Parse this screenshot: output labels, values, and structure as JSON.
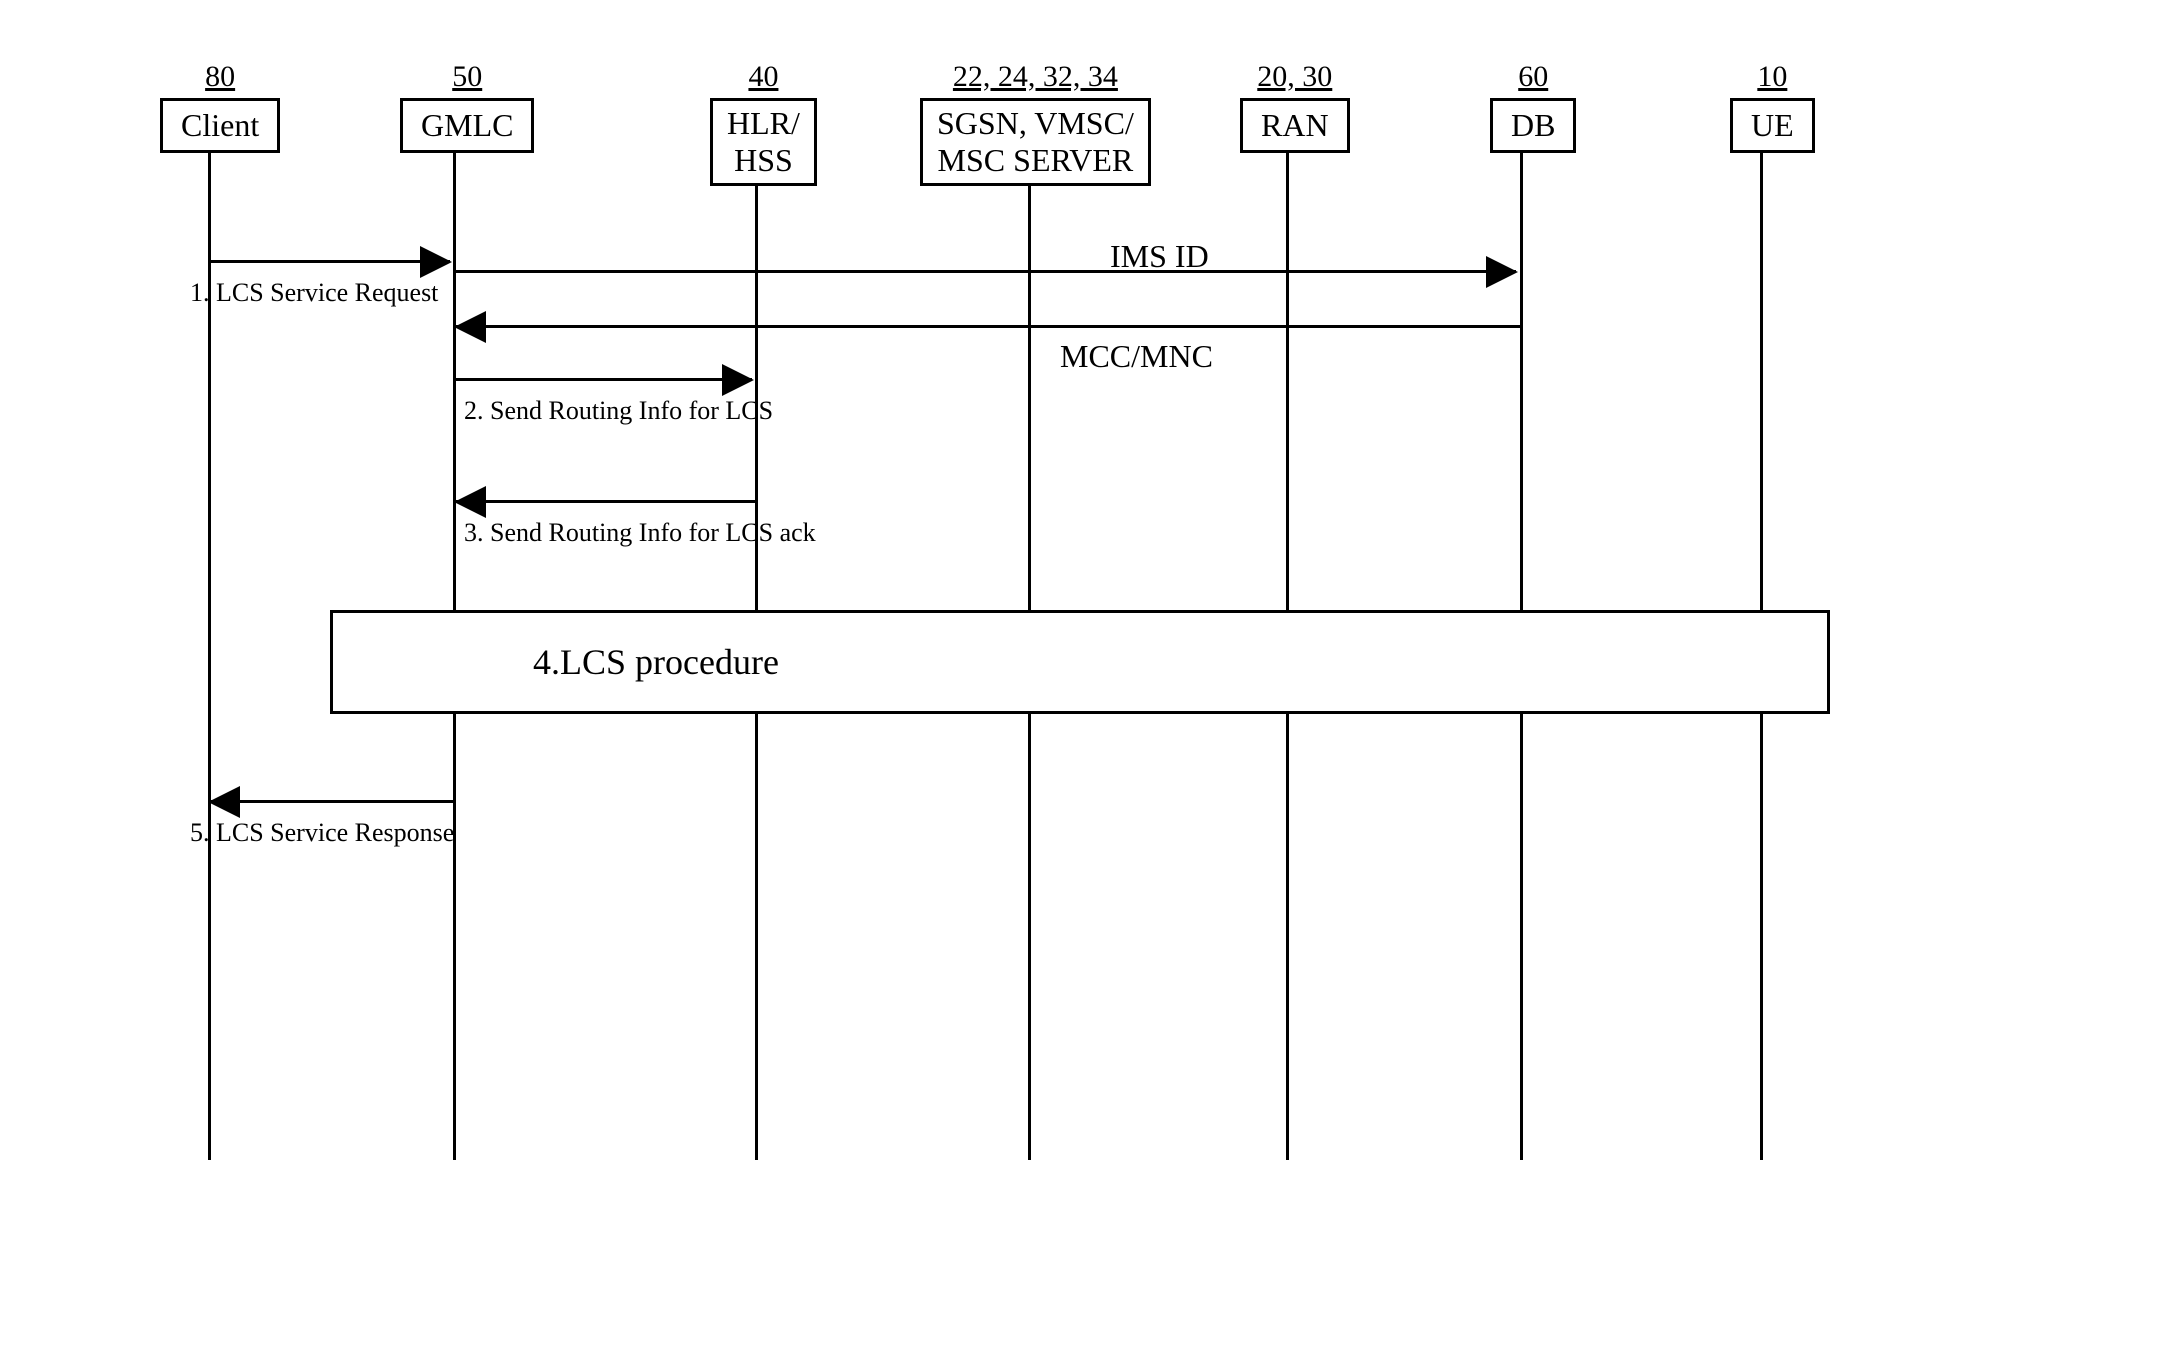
{
  "participants": {
    "client": {
      "number": "80",
      "label": "Client"
    },
    "gmlc": {
      "number": "50",
      "label": "GMLC"
    },
    "hlr": {
      "number": "40",
      "label1": "HLR/",
      "label2": "HSS"
    },
    "sgsn": {
      "number": "22, 24, 32, 34",
      "label1": "SGSN, VMSC/",
      "label2": "MSC SERVER"
    },
    "ran": {
      "number": "20, 30",
      "label": "RAN"
    },
    "db": {
      "number": "60",
      "label": "DB"
    },
    "ue": {
      "number": "10",
      "label": "UE"
    }
  },
  "messages": {
    "m1": "1. LCS Service Request",
    "ims": "IMS ID",
    "mcc": "MCC/MNC",
    "m2": "2. Send Routing Info for LCS",
    "m3": "3. Send Routing Info for LCS ack",
    "m4": "4.LCS procedure",
    "m5": "5. LCS Service Response"
  }
}
